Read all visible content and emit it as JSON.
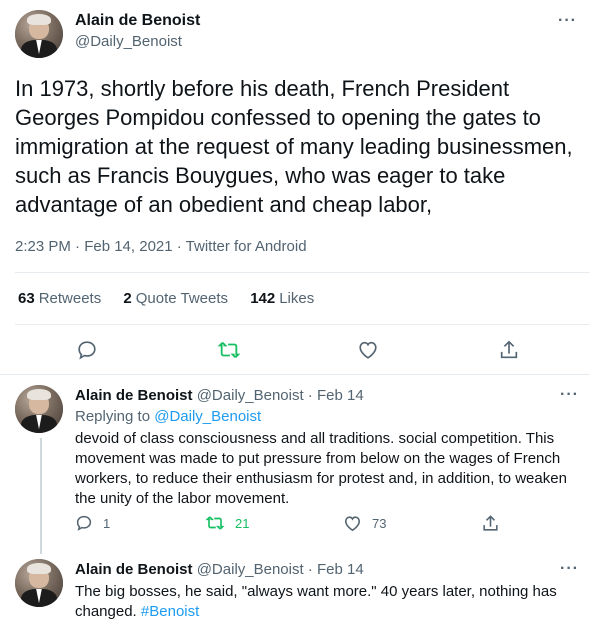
{
  "main_tweet": {
    "name": "Alain de Benoist",
    "handle": "@Daily_Benoist",
    "text": "In 1973, shortly before his death, French President Georges Pompidou confessed to opening the gates to immigration at the request of many leading businessmen, such as Francis Bouygues, who was eager to take advantage of an obedient and cheap labor,",
    "meta": "2:23 PM · Feb 14, 2021 · Twitter for Android",
    "stats": {
      "retweets_count": "63",
      "retweets_label": "Retweets",
      "quotes_count": "2",
      "quotes_label": "Quote Tweets",
      "likes_count": "142",
      "likes_label": "Likes"
    },
    "more_icon": "more-horizontal-icon"
  },
  "replies": [
    {
      "name": "Alain de Benoist",
      "handle_date": "@Daily_Benoist · Feb 14",
      "replying_prefix": "Replying to",
      "replying_to": "@Daily_Benoist",
      "text": "devoid of class consciousness and all traditions. social competition. This movement was made to put pressure from below on the wages of French workers, to reduce their enthusiasm for protest and, in addition, to weaken the unity of the labor movement.",
      "reply_count": "1",
      "retweet_count": "21",
      "like_count": "73"
    },
    {
      "name": "Alain de Benoist",
      "handle_date": "@Daily_Benoist · Feb 14",
      "text": "The big bosses, he said, \"always want more.\" 40 years later, nothing has changed.",
      "hashtag": "#Benoist"
    }
  ],
  "colors": {
    "accent": "#1d9bf0",
    "retweet_green": "#17bf63",
    "muted": "#536471",
    "text": "#0f1419"
  }
}
